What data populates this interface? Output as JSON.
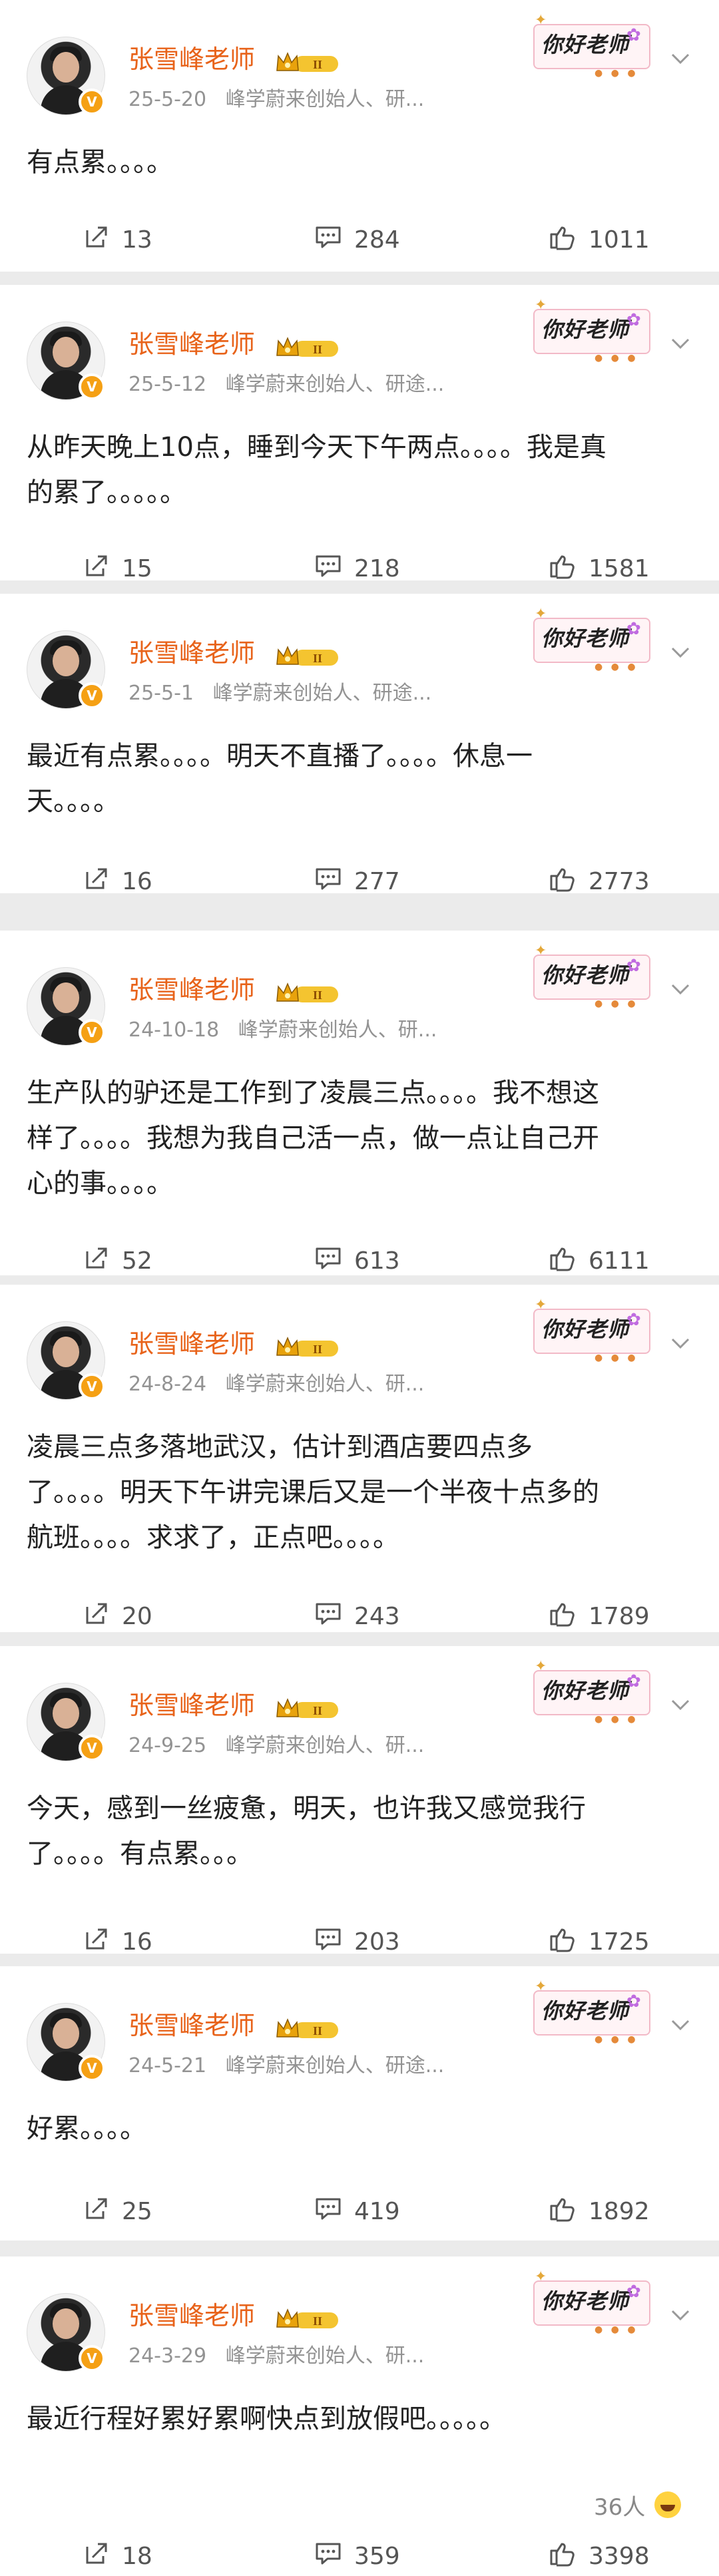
{
  "author": {
    "name": "张雪峰老师",
    "verified_badge": "V",
    "sticker_text": "你好老师",
    "icons": [
      "avatar",
      "verified-badge-icon",
      "crown-rank-badge-icon",
      "sticker-image",
      "chevron-down-icon",
      "repost-icon",
      "comment-icon",
      "like-icon"
    ]
  },
  "colors": {
    "name": "#e8631a",
    "meta": "#939393",
    "badge": "#f5a014",
    "background": "#ebebeb"
  },
  "posts": [
    {
      "date": "25-5-20",
      "source": "峰学蔚来创始人、研...",
      "lines": [
        "有点累。。。。"
      ],
      "reposts": "13",
      "comments": "284",
      "likes": "1011"
    },
    {
      "date": "25-5-12",
      "source": "峰学蔚来创始人、研途...",
      "lines": [
        "从昨天晚上10点，睡到今天下午两点。。。。我是真",
        "的累了。。。。。"
      ],
      "reposts": "15",
      "comments": "218",
      "likes": "1581"
    },
    {
      "date": "25-5-1",
      "source": "峰学蔚来创始人、研途...",
      "lines": [
        "最近有点累。。。。明天不直播了。。。。休息一",
        "天。。。。"
      ],
      "reposts": "16",
      "comments": "277",
      "likes": "2773"
    },
    {
      "date": "24-10-18",
      "source": "峰学蔚来创始人、研...",
      "lines": [
        "生产队的驴还是工作到了凌晨三点。。。。我不想这",
        "样了。。。。我想为我自己活一点，做一点让自己开",
        "心的事。。。。"
      ],
      "reposts": "52",
      "comments": "613",
      "likes": "6111"
    },
    {
      "date": "24-8-24",
      "source": "峰学蔚来创始人、研...",
      "lines": [
        "凌晨三点多落地武汉，估计到酒店要四点多",
        "了。。。。明天下午讲完课后又是一个半夜十点多的",
        "航班。。。。求求了，正点吧。。。。"
      ],
      "reposts": "20",
      "comments": "243",
      "likes": "1789"
    },
    {
      "date": "24-9-25",
      "source": "峰学蔚来创始人、研...",
      "lines": [
        "今天，感到一丝疲惫，明天，也许我又感觉我行",
        "了。。。。有点累。。。"
      ],
      "reposts": "16",
      "comments": "203",
      "likes": "1725"
    },
    {
      "date": "24-5-21",
      "source": "峰学蔚来创始人、研途...",
      "lines": [
        "好累。。。。"
      ],
      "reposts": "25",
      "comments": "419",
      "likes": "1892"
    },
    {
      "date": "24-3-29",
      "source": "峰学蔚来创始人、研...",
      "lines": [
        "最近行程好累好累啊快点到放假吧。。。。。"
      ],
      "reactions": "36人",
      "reposts": "18",
      "comments": "359",
      "likes": "3398"
    }
  ]
}
